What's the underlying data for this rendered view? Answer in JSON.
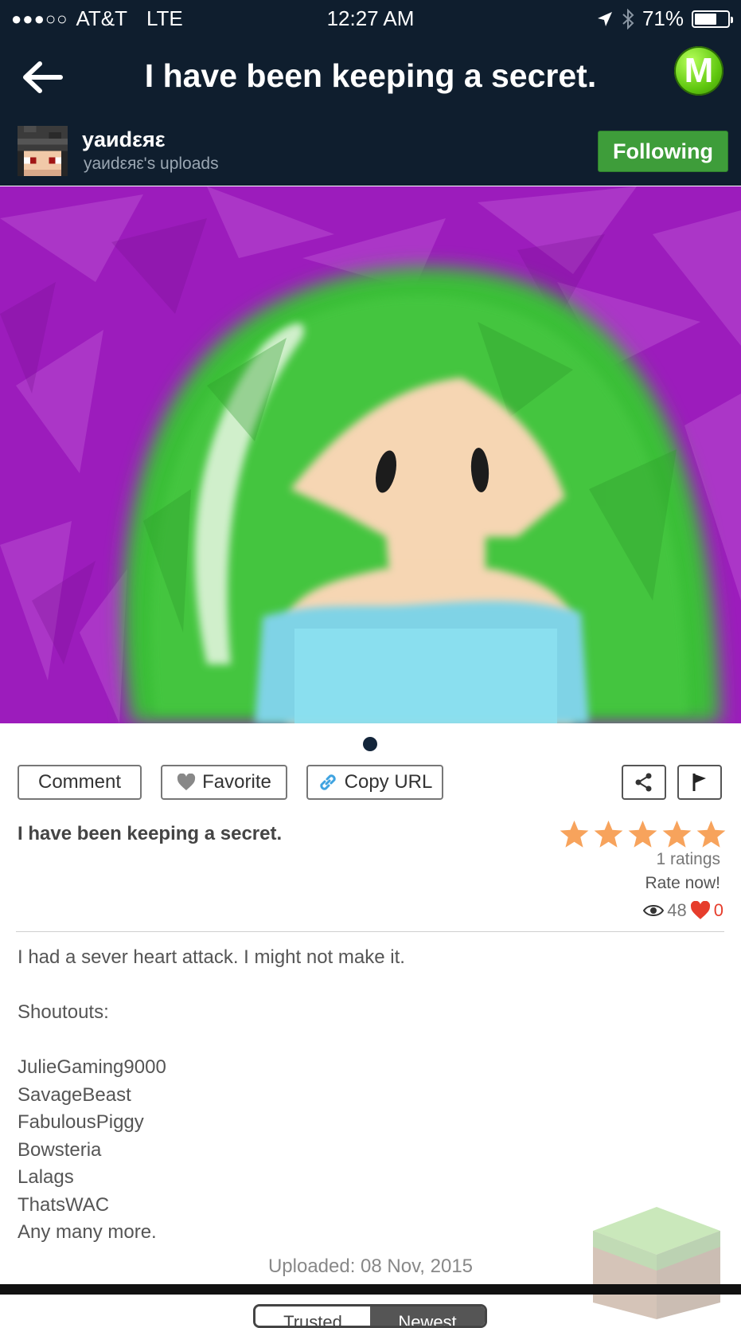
{
  "status_bar": {
    "signal_dots": "●●●○○",
    "carrier": "AT&T",
    "network": "LTE",
    "time": "12:27 AM",
    "battery_percent": "71%",
    "battery_level": 0.71
  },
  "nav": {
    "title": "I have been keeping a secret.",
    "logo_letter": "M"
  },
  "user": {
    "name": "yaиdεяε",
    "subtitle": "yaиdεяε's uploads",
    "follow_label": "Following"
  },
  "gallery": {
    "page_count": 1,
    "current_page": 1
  },
  "actions": {
    "comment": "Comment",
    "favorite": "Favorite",
    "copy_url": "Copy URL"
  },
  "post": {
    "title": "I have been keeping a secret.",
    "stars": 5,
    "ratings": "1 ratings",
    "rate_now": "Rate now!",
    "views": "48",
    "likes": "0",
    "description_lines": [
      "I had a sever heart attack. I might not make it.",
      "",
      "Shoutouts:",
      "",
      "JulieGaming9000",
      "SavageBeast",
      "FabulousPiggy",
      "Bowsteria",
      "Lalags",
      "ThatsWAC",
      "Any many more."
    ],
    "uploaded": "Uploaded: 08 Nov, 2015"
  },
  "tabs": [
    "Trusted",
    "Newest"
  ],
  "colors": {
    "header_bg": "#0f1e2e",
    "follow_green": "#3e9d3a",
    "star_orange": "#f7a35c",
    "heart_red": "#e63d2c",
    "art_purple": "#9818b8",
    "hair_green": "#3fc23a"
  }
}
